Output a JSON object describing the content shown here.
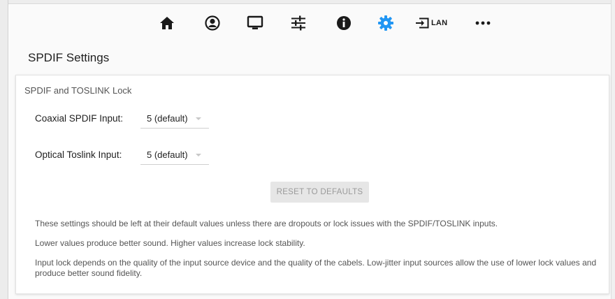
{
  "colors": {
    "accent": "#2196f3",
    "icon_dark": "#1a1a1a",
    "card_bg": "#ffffff",
    "page_bg": "#fafafa",
    "button_bg": "#e6e6e6",
    "button_text": "#9a9a9a"
  },
  "navbar": {
    "items": [
      {
        "icon": "home-icon"
      },
      {
        "icon": "user-icon"
      },
      {
        "icon": "monitor-icon"
      },
      {
        "icon": "sliders-icon"
      },
      {
        "icon": "info-icon"
      },
      {
        "icon": "gear-icon",
        "active": true
      },
      {
        "icon": "input-icon",
        "label": "LAN"
      },
      {
        "icon": "more-icon"
      }
    ]
  },
  "page": {
    "title": "SPDIF Settings"
  },
  "card": {
    "title": "SPDIF and TOSLINK Lock",
    "fields": [
      {
        "label": "Coaxial SPDIF Input:",
        "value": "5 (default)"
      },
      {
        "label": "Optical Toslink Input:",
        "value": "5 (default)"
      }
    ],
    "reset_label": "RESET TO DEFAULTS",
    "notes": [
      "These settings should be left at their default values unless there are dropouts or lock issues with the SPDIF/TOSLINK inputs.",
      "Lower values produce better sound. Higher values increase lock stability.",
      "Input lock depends on the quality of the input source device and the quality of the cabels. Low-jitter input sources allow the use of lower lock values and produce better sound fidelity."
    ]
  }
}
